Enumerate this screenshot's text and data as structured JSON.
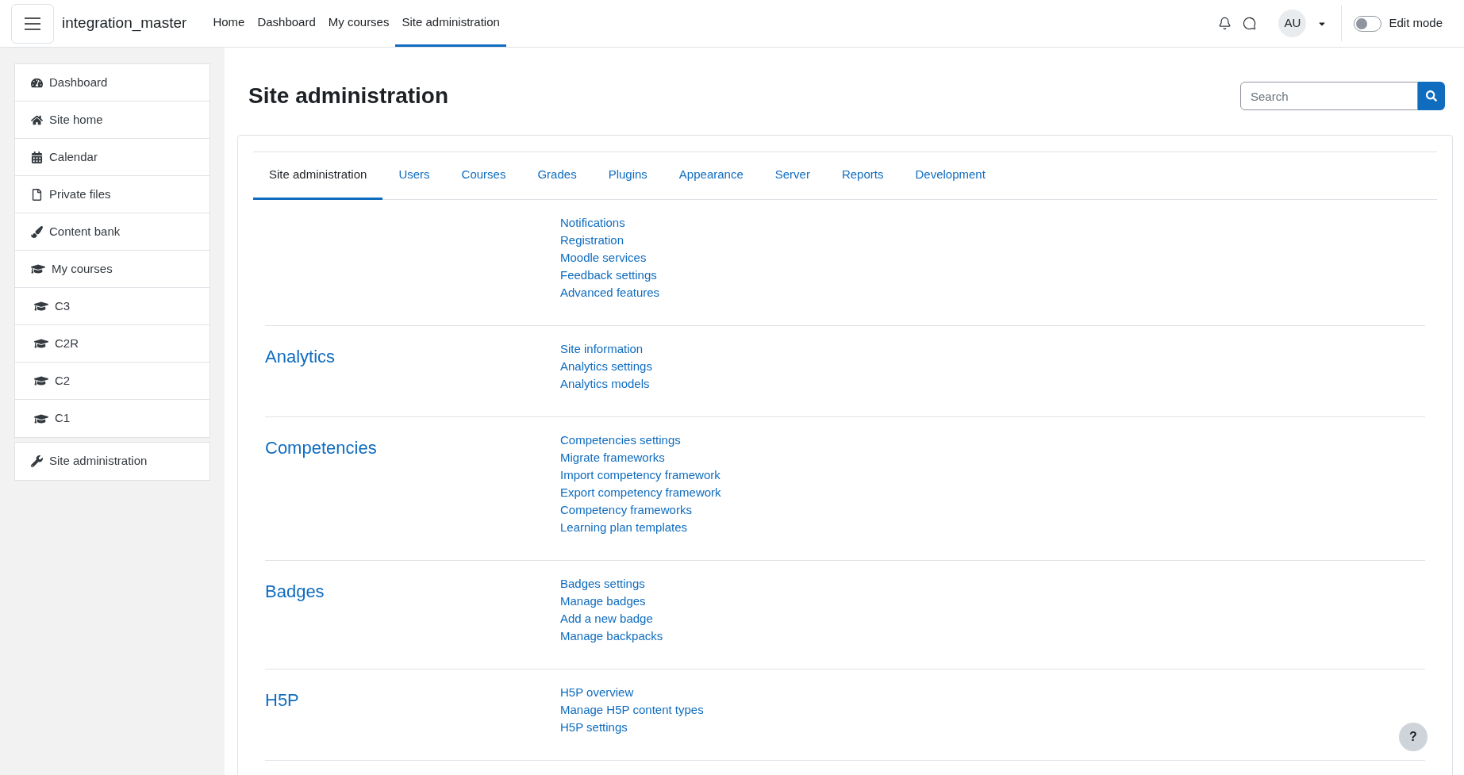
{
  "header": {
    "site_name": "integration_master",
    "nav": [
      {
        "label": "Home",
        "selected": false
      },
      {
        "label": "Dashboard",
        "selected": false
      },
      {
        "label": "My courses",
        "selected": false
      },
      {
        "label": "Site administration",
        "selected": true
      }
    ],
    "avatar": "AU",
    "edit_mode": {
      "label": "Edit mode",
      "on": false
    }
  },
  "sidebar": {
    "items": [
      {
        "label": "Dashboard",
        "kind": "dashboard"
      },
      {
        "label": "Site home",
        "kind": "home"
      },
      {
        "label": "Calendar",
        "kind": "calendar"
      },
      {
        "label": "Private files",
        "kind": "file"
      },
      {
        "label": "Content bank",
        "kind": "brush"
      },
      {
        "label": "My courses",
        "kind": "courses"
      },
      {
        "label": "C3",
        "kind": "course"
      },
      {
        "label": "C2R",
        "kind": "course"
      },
      {
        "label": "C2",
        "kind": "course"
      },
      {
        "label": "C1",
        "kind": "course"
      }
    ],
    "footer_item": {
      "label": "Site administration",
      "kind": "wrench"
    }
  },
  "page": {
    "title": "Site administration",
    "search": {
      "placeholder": "Search"
    },
    "tabs": [
      {
        "label": "Site administration",
        "selected": true
      },
      {
        "label": "Users",
        "selected": false
      },
      {
        "label": "Courses",
        "selected": false
      },
      {
        "label": "Grades",
        "selected": false
      },
      {
        "label": "Plugins",
        "selected": false
      },
      {
        "label": "Appearance",
        "selected": false
      },
      {
        "label": "Server",
        "selected": false
      },
      {
        "label": "Reports",
        "selected": false
      },
      {
        "label": "Development",
        "selected": false
      }
    ],
    "sections": [
      {
        "links": [
          "Notifications",
          "Registration",
          "Moodle services",
          "Feedback settings",
          "Advanced features"
        ]
      },
      {
        "heading": "Analytics",
        "links": [
          "Site information",
          "Analytics settings",
          "Analytics models"
        ]
      },
      {
        "heading": "Competencies",
        "links": [
          "Competencies settings",
          "Migrate frameworks",
          "Import competency framework",
          "Export competency framework",
          "Competency frameworks",
          "Learning plan templates"
        ]
      },
      {
        "heading": "Badges",
        "links": [
          "Badges settings",
          "Manage badges",
          "Add a new badge",
          "Manage backpacks"
        ]
      },
      {
        "heading": "H5P",
        "links": [
          "H5P overview",
          "Manage H5P content types",
          "H5P settings"
        ]
      }
    ]
  },
  "help_button": "?"
}
